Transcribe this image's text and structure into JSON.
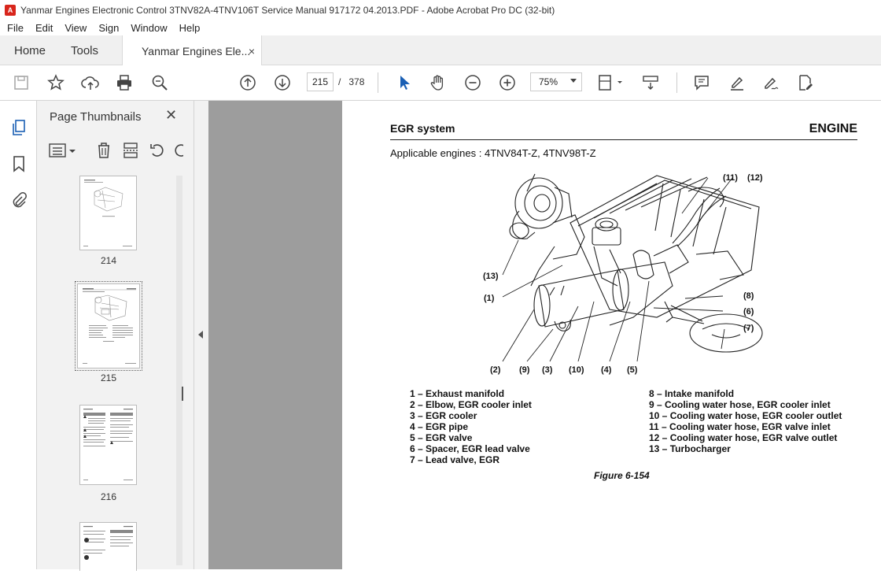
{
  "window": {
    "title": "Yanmar Engines Electronic Control 3TNV82A-4TNV106T Service Manual 917172 04.2013.PDF - Adobe Acrobat Pro DC (32-bit)",
    "app_icon": "pdf-icon"
  },
  "menu": [
    "File",
    "Edit",
    "View",
    "Sign",
    "Window",
    "Help"
  ],
  "tabs": {
    "home": "Home",
    "tools": "Tools",
    "document": "Yanmar Engines Ele...",
    "close": "×"
  },
  "toolbar": {
    "current_page": "215",
    "page_separator": "/",
    "total_pages": "378",
    "zoom": "75%"
  },
  "thumbnail_panel": {
    "title": "Page Thumbnails",
    "close": "✕",
    "thumbnails": [
      {
        "label": "214",
        "selected": false
      },
      {
        "label": "215",
        "selected": true
      },
      {
        "label": "216",
        "selected": false
      }
    ]
  },
  "page": {
    "section": "EGR system",
    "chapter": "ENGINE",
    "applicable": "Applicable engines : 4TNV84T-Z, 4TNV98T-Z",
    "callouts": [
      "(11)",
      "(12)",
      "(13)",
      "(1)",
      "(8)",
      "(6)",
      "(7)",
      "(2)",
      "(9)",
      "(3)",
      "(10)",
      "(4)",
      "(5)"
    ],
    "legend_left": [
      "1 – Exhaust manifold",
      "2 – Elbow, EGR cooler inlet",
      "3 – EGR cooler",
      "4 – EGR pipe",
      "5 – EGR valve",
      "6 – Spacer, EGR lead valve",
      "7 – Lead valve, EGR"
    ],
    "legend_right": [
      "8 – Intake manifold",
      "9 – Cooling water hose, EGR cooler inlet",
      "10 – Cooling water hose, EGR cooler outlet",
      "11 – Cooling water hose, EGR valve inlet",
      "12 – Cooling water hose, EGR valve outlet",
      "13 – Turbocharger"
    ],
    "figure_caption": "Figure 6-154"
  },
  "colors": {
    "accent_blue": "#1a5fb4",
    "viewer_bg": "#9d9d9d",
    "app_red": "#d8261c"
  }
}
